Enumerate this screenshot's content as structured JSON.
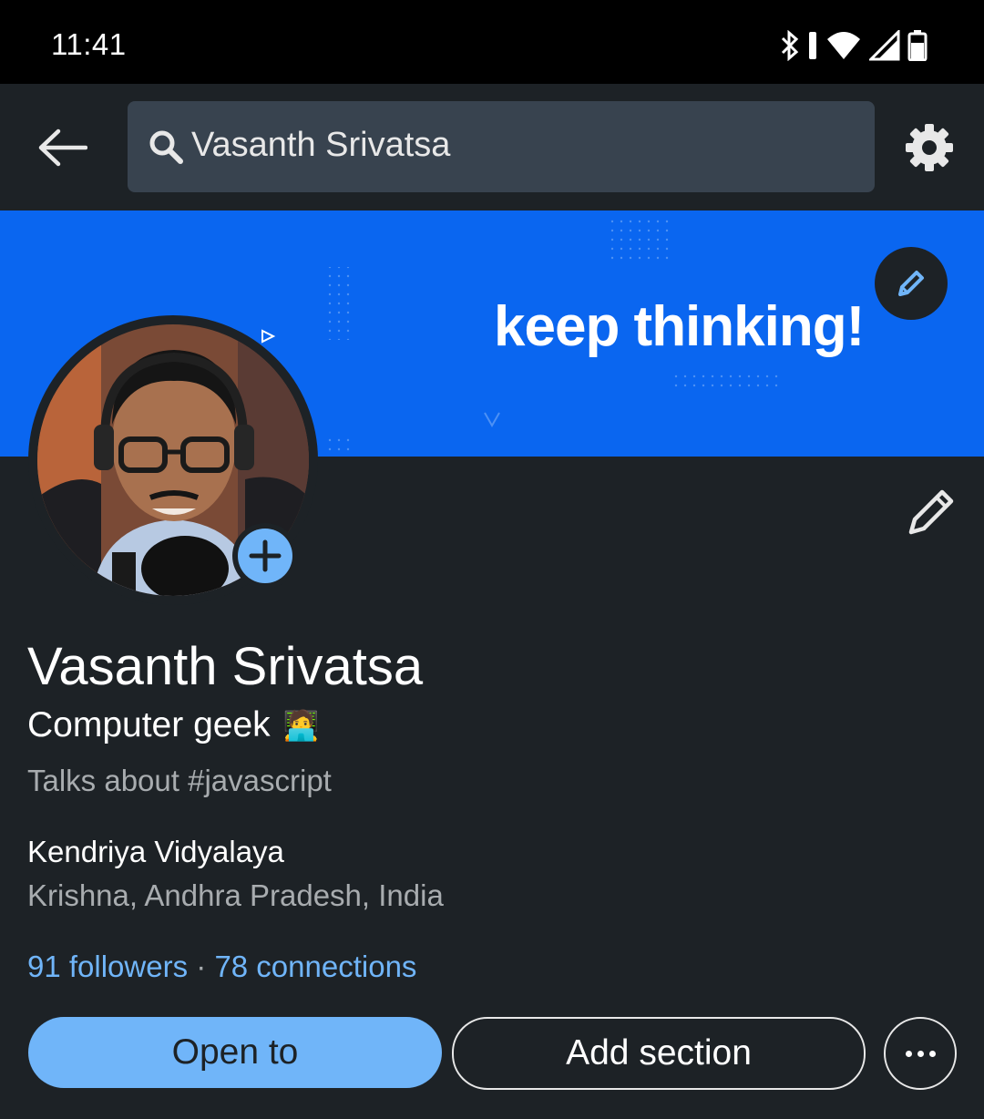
{
  "status_bar": {
    "time": "11:41",
    "icons": [
      "bluetooth-icon",
      "vibrate-icon",
      "wifi-icon",
      "signal-icon",
      "battery-icon"
    ]
  },
  "top_bar": {
    "search": {
      "value": "Vasanth Srivatsa",
      "placeholder": "Search"
    },
    "back_icon": "back-arrow-icon",
    "settings_icon": "gear-icon"
  },
  "banner": {
    "text": "keep thinking!",
    "background_color": "#0a66f0",
    "edit_icon": "pencil-icon"
  },
  "profile": {
    "name": "Vasanth Srivatsa",
    "headline": "Computer geek",
    "headline_emoji": "🧑‍💻",
    "talks_about": "Talks about #javascript",
    "school": "Kendriya Vidyalaya",
    "location": "Krishna, Andhra Pradesh, India",
    "followers": "91 followers",
    "separator": "·",
    "connections": "78 connections"
  },
  "actions": {
    "open_to": "Open to",
    "add_section": "Add section",
    "more_icon": "more-horizontal-icon"
  },
  "colors": {
    "background": "#1d2226",
    "accent": "#70b5f9",
    "search_bg": "#38434f",
    "muted_text": "#a8acaf"
  }
}
